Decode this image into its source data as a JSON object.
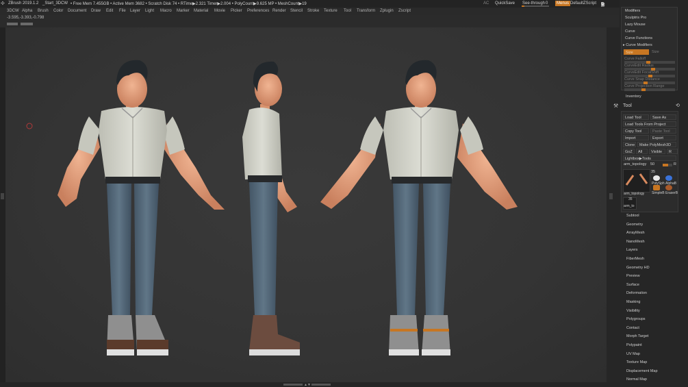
{
  "title_bar": {
    "app_version": "ZBrush 2019.1.2",
    "document": "_Start_3DCW",
    "status": "• Free Mem 7.455GB • Active Mem 3682 • Scratch Disk 74 • RTime▶2.321 Timer▶2.004 • PolyCount▶9.625 MP • MeshCount▶19",
    "ac": "AC",
    "quicksave": "QuickSave",
    "see_through": "See-through",
    "see_through_value": "0",
    "menus": "Menus",
    "default_zscript": "DefaultZScript"
  },
  "menu_bar": [
    "3DCW",
    "Alpha",
    "Brush",
    "Color",
    "Document",
    "Draw",
    "Edit",
    "File",
    "Layer",
    "Light",
    "Macro",
    "Marker",
    "Material",
    "Movie",
    "Picker",
    "Preferences",
    "Render",
    "Stencil",
    "Stroke",
    "Texture",
    "Tool",
    "Transform",
    "Zplugin",
    "Zscript"
  ],
  "coords": "-3.595,-3.393,-0.798",
  "stroke_panel": {
    "items": [
      "Modifiers",
      "Sculptris Pro",
      "Lazy Mouse",
      "Curve",
      "Curve Functions",
      "Curve Modifiers"
    ],
    "toggle_active": "Size",
    "toggle_dim": "Size",
    "sliders": [
      "Curve Falloff",
      "CurveEdit Radius",
      "CurveEdit FocalShift",
      "Curve Snap Distance",
      "Curve Projection Range"
    ],
    "slider_levels": [
      0.45,
      0.55,
      0.5,
      0.4,
      0.35
    ],
    "inventory": "Inventory"
  },
  "tool_panel": {
    "title": "Tool",
    "rows": [
      [
        "Load Tool",
        "Save As"
      ],
      [
        "Load Tools From Project"
      ],
      [
        "Copy Tool",
        "Paste Tool"
      ],
      [
        "Import",
        "Export"
      ],
      [
        "Clone",
        "Make PolyMesh3D"
      ],
      [
        "GoZ",
        "All",
        "Visible",
        "R"
      ],
      [
        "Lightbox▶Tools"
      ]
    ],
    "current_tool": "arm_topology",
    "current_value": "50",
    "current_r": "R",
    "thumb_count": "35",
    "thumb_labels": [
      "arm_topology",
      "PolySph",
      "AlphaB",
      "SimpleB",
      "EraserB"
    ],
    "small_thumb_count": "35",
    "small_thumb_label": "arm_to",
    "subpalettes": [
      "Subtool",
      "Geometry",
      "ArrayMesh",
      "NanoMesh",
      "Layers",
      "FiberMesh",
      "Geometry HD",
      "Preview",
      "Surface",
      "Deformation",
      "Masking",
      "Visibility",
      "Polygroups",
      "Contact",
      "Morph Target",
      "Polypaint",
      "UV Map",
      "Texture Map",
      "Displacement Map",
      "Normal Map"
    ]
  },
  "colors": {
    "accent": "#c77622",
    "skin": "#e4a07e",
    "shirt": "#d4d5cb",
    "jeans": "#5a6f80",
    "hair": "#23282c",
    "sneaker": "#8d8d8d"
  }
}
